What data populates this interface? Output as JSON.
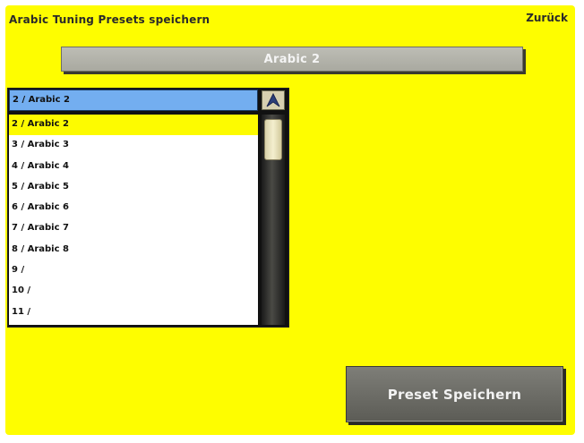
{
  "header": {
    "title": "Arabic Tuning Presets speichern",
    "back_label": "Zurück"
  },
  "name_field": {
    "value": "Arabic 2"
  },
  "dropdown": {
    "selected_value": "2 / Arabic 2",
    "arrow_icon": "up-arrow-icon",
    "items": [
      {
        "label": "2 / Arabic 2",
        "selected": true
      },
      {
        "label": "3 / Arabic 3"
      },
      {
        "label": "4 / Arabic 4"
      },
      {
        "label": "5 / Arabic 5"
      },
      {
        "label": "6 / Arabic 6"
      },
      {
        "label": "7 / Arabic 7"
      },
      {
        "label": "8 / Arabic 8"
      },
      {
        "label": "9 /"
      },
      {
        "label": "10 /"
      },
      {
        "label": "11 /"
      }
    ]
  },
  "actions": {
    "save_label": "Preset Speichern"
  },
  "colors": {
    "background": "#fefd00",
    "selected_item": "#fdfb00",
    "dropdown_header": "#73aef0",
    "button": "#6e6e68"
  }
}
